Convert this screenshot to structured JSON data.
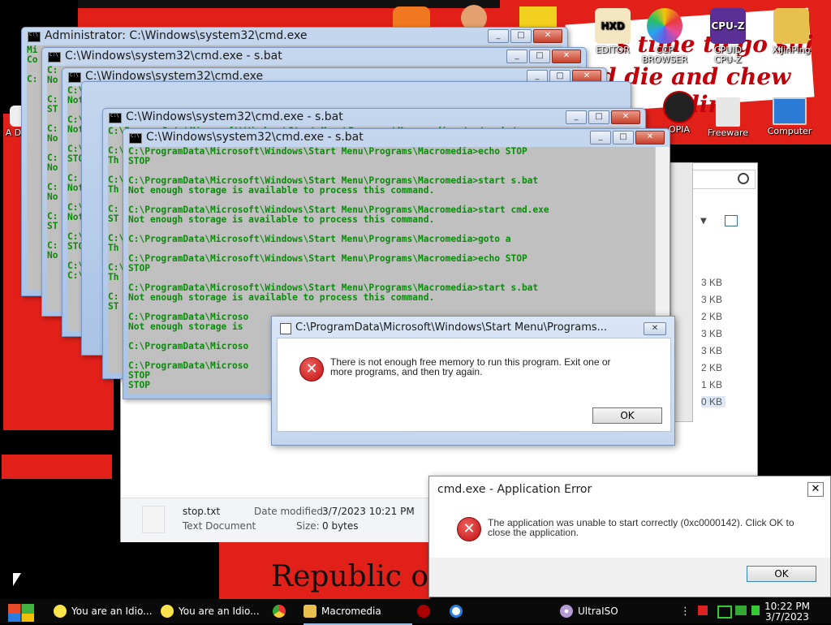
{
  "desktop_icons": [
    {
      "label": "EDITOR",
      "color": "#e9a030"
    },
    {
      "label": "CCP BROWSER",
      "color": "#e84c9a"
    },
    {
      "label": "CPUID CPU-Z",
      "color": "#6a3da8"
    },
    {
      "label": "XiJinPing",
      "color": "#d8b040"
    },
    {
      "label": "OPIA",
      "color": "#222222"
    },
    {
      "label": "Freeware",
      "color": "#c9c9c9"
    },
    {
      "label": "Computer",
      "color": "#2b7bd6"
    }
  ],
  "left_icon_fragment": {
    "label": "A Det"
  },
  "wallpaper_text": {
    "line1": "s time to go shi",
    "line2": "d die and chew",
    "line3": "illin",
    "republic": "Republic of"
  },
  "cmd_windows": [
    {
      "title": "Administrator: C:\\Windows\\system32\\cmd.exe",
      "lines": [
        "Mi",
        "Co",
        "",
        "C:",
        "",
        "",
        "",
        "",
        "",
        "",
        "",
        "",
        "",
        ""
      ]
    },
    {
      "title": "C:\\Windows\\system32\\cmd.exe - s.bat",
      "lines": [
        "C:",
        "No",
        "",
        "C:",
        "ST",
        "",
        "C:",
        "No",
        "",
        "C:",
        "No",
        "",
        "C:",
        "No",
        "",
        "C:",
        "ST",
        "",
        "C:",
        "No"
      ]
    },
    {
      "title": "C:\\Windows\\system32\\cmd.exe",
      "lines": [
        "C:\\Pr",
        "Not e",
        "",
        "C:\\Pr",
        "Not e",
        "",
        "C:\\Pr",
        "STOP",
        "",
        "C:",
        "Not e",
        "",
        "C:\\Pr",
        "Not e",
        "",
        "C:\\Pr",
        "STOP",
        "",
        "C:\\Pr",
        "C:\\Pr"
      ]
    },
    {
      "title": "C:\\Windows\\system32\\cmd.exe - s.bat",
      "lines": [
        "C:\\ProgramData\\Microsoft\\Windows\\Start Menu\\Programs\\Macromedia>start s.bat",
        "",
        "C:\\Pr",
        "Th",
        "",
        "C:\\Pr",
        "Th",
        "",
        "C:",
        "ST",
        "",
        "C:\\Pr",
        "Th",
        "",
        "C:\\Pr",
        "Th",
        "",
        "C:",
        "ST"
      ]
    },
    {
      "title": "C:\\Windows\\system32\\cmd.exe - s.bat",
      "lines": [
        "C:\\ProgramData\\Microsoft\\Windows\\Start Menu\\Programs\\Macromedia>echo STOP",
        "STOP",
        "",
        "C:\\ProgramData\\Microsoft\\Windows\\Start Menu\\Programs\\Macromedia>start s.bat",
        "Not enough storage is available to process this command.",
        "",
        "C:\\ProgramData\\Microsoft\\Windows\\Start Menu\\Programs\\Macromedia>start cmd.exe",
        "Not enough storage is available to process this command.",
        "",
        "C:\\ProgramData\\Microsoft\\Windows\\Start Menu\\Programs\\Macromedia>goto a",
        "",
        "C:\\ProgramData\\Microsoft\\Windows\\Start Menu\\Programs\\Macromedia>echo STOP",
        "STOP",
        "",
        "C:\\ProgramData\\Microsoft\\Windows\\Start Menu\\Programs\\Macromedia>start s.bat",
        "Not enough storage is available to process this command.",
        "",
        "C:\\ProgramData\\Microso",
        "Not enough storage is",
        "",
        "C:\\ProgramData\\Microso",
        "",
        "C:\\ProgramData\\Microso",
        "STOP",
        "STOP"
      ]
    }
  ],
  "explorer": {
    "sizes": [
      "3 KB",
      "3 KB",
      "2 KB",
      "3 KB",
      "3 KB",
      "2 KB",
      "1 KB",
      "0 KB"
    ],
    "selected_file": {
      "name": "stop.txt",
      "type": "Text Document",
      "modified_label": "Date modified:",
      "modified_value": "3/7/2023 10:21 PM",
      "size_label": "Size:",
      "size_value": "0 bytes"
    }
  },
  "memory_dialog": {
    "title": "C:\\ProgramData\\Microsoft\\Windows\\Start Menu\\Programs...",
    "message": "There is not enough free memory to run this program. Exit one or more programs, and then try again.",
    "ok_label": "OK"
  },
  "app_error_dialog": {
    "title": "cmd.exe - Application Error",
    "message": "The application was unable to start correctly (0xc0000142). Click OK to close the application.",
    "ok_label": "OK"
  },
  "taskbar": {
    "items": [
      {
        "label": "You are an Idio...",
        "icon": "smiley-icon"
      },
      {
        "label": "You are an Idio...",
        "icon": "smiley-icon"
      },
      {
        "label": "",
        "icon": "chrome-icon"
      },
      {
        "label": "Macromedia",
        "icon": "folder-icon"
      },
      {
        "label": "",
        "icon": "app-icon"
      },
      {
        "label": "",
        "icon": "app-icon"
      },
      {
        "label": "UltraISO",
        "icon": "disc-icon"
      }
    ],
    "clock_time": "10:22 PM",
    "clock_date": "3/7/2023"
  }
}
